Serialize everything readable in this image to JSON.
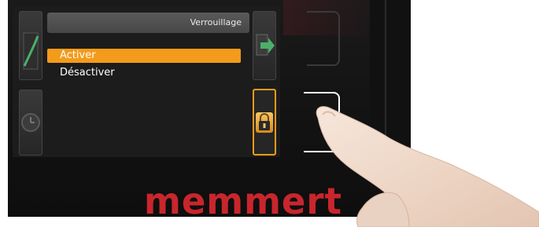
{
  "menu": {
    "title": "Verrouillage",
    "items": [
      {
        "label": "Activer",
        "selected": true
      },
      {
        "label": "Désactiver",
        "selected": false
      }
    ]
  },
  "brand": {
    "name": "memmert",
    "color": "#c8262c"
  },
  "colors": {
    "accent": "#f39b1a",
    "screen_background": "#1c1c1c",
    "header_background": "#555555"
  },
  "icons": {
    "top_left": "ramp-icon",
    "mid_left": "clock-icon",
    "top_right": "export-icon",
    "lock": "lock-icon"
  }
}
